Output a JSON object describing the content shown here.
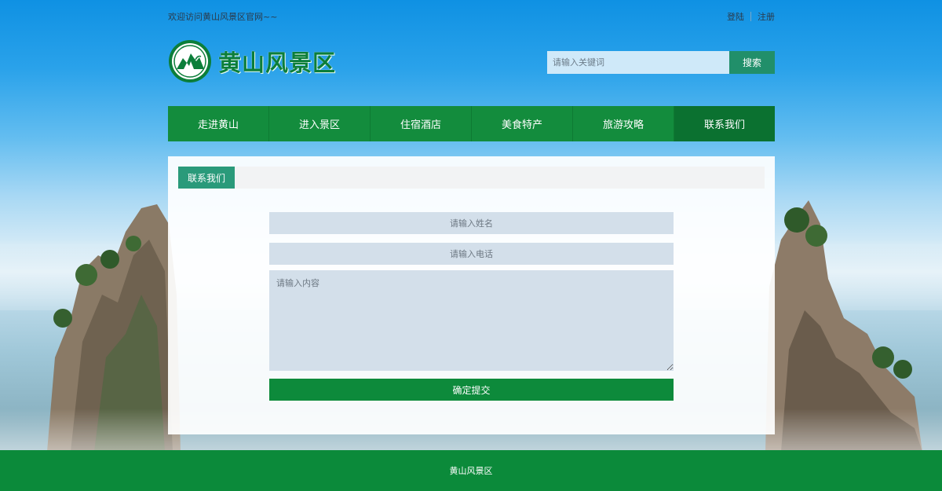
{
  "topbar": {
    "welcome": "欢迎访问黄山风景区官网~~",
    "login": "登陆",
    "register": "注册"
  },
  "header": {
    "logo_text": "黄山风景区",
    "search": {
      "placeholder": "请输入关键词",
      "button": "搜索"
    }
  },
  "nav": {
    "items": [
      {
        "label": "走进黄山"
      },
      {
        "label": "进入景区"
      },
      {
        "label": "住宿酒店"
      },
      {
        "label": "美食特产"
      },
      {
        "label": "旅游攻略"
      },
      {
        "label": "联系我们"
      }
    ],
    "active_index": 5
  },
  "contact": {
    "tab_title": "联系我们",
    "name_placeholder": "请输入姓名",
    "phone_placeholder": "请输入电话",
    "content_placeholder": "请输入内容",
    "submit": "确定提交"
  },
  "footer": {
    "text": "黄山风景区"
  },
  "colors": {
    "primary_green": "#138c3d",
    "active_green": "#0b7130",
    "teal": "#2a9a7a",
    "sky_blue": "#0f91e3",
    "input_bg": "#d3dfea"
  },
  "icons": {
    "logo": "huangshan-emblem-icon"
  }
}
